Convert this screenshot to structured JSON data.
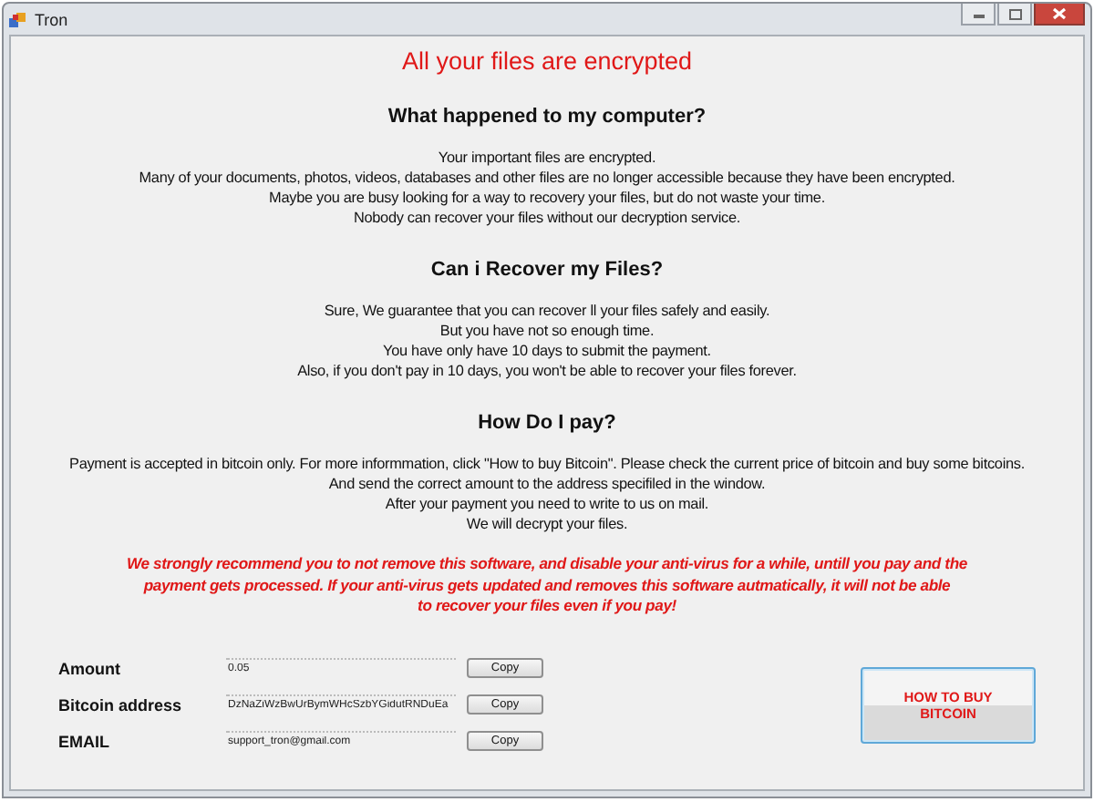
{
  "window": {
    "title": "Tron"
  },
  "headline": "All your files are encrypted",
  "sections": [
    {
      "heading": "What happened to my computer?",
      "lines": [
        "Your important files are encrypted.",
        "Many of your documents, photos, videos, databases and other files are no longer accessible because they have been encrypted.",
        "Maybe you are busy looking for a way to recovery your files, but do not waste your time.",
        "Nobody can recover your files without our decryption service."
      ]
    },
    {
      "heading": "Can i Recover my Files?",
      "lines": [
        "Sure, We guarantee that you can recover ll your files safely and easily.",
        "But you have not so enough time.",
        "You have only have 10 days to submit the payment.",
        "Also, if you don't pay in 10 days, you won't be able to recover your files forever."
      ]
    },
    {
      "heading": "How Do I pay?",
      "lines": [
        "Payment is accepted in bitcoin only. For more informmation, click \"How to buy Bitcoin\". Please check the current price of bitcoin and buy some bitcoins.",
        "And send the correct amount to the address specifiled in the window.",
        "After your payment you need to write to us on mail.",
        "We will decrypt your files."
      ]
    }
  ],
  "warning": [
    "We strongly recommend you to not remove this software, and disable your anti-virus for a while, untill you pay and the",
    "payment gets processed. If your anti-virus gets updated and removes this software autmatically, it will not be able",
    "to recover your files even if you pay!"
  ],
  "fields": [
    {
      "label": "Amount",
      "value": "0.05",
      "button": "Copy"
    },
    {
      "label": "Bitcoin address",
      "value": "DzNaZiWzBwUrBymWHcSzbYGidutRNDuEa",
      "button": "Copy"
    },
    {
      "label": "EMAIL",
      "value": "support_tron@gmail.com",
      "button": "Copy"
    }
  ],
  "buy_button": "HOW TO BUY BITCOIN"
}
